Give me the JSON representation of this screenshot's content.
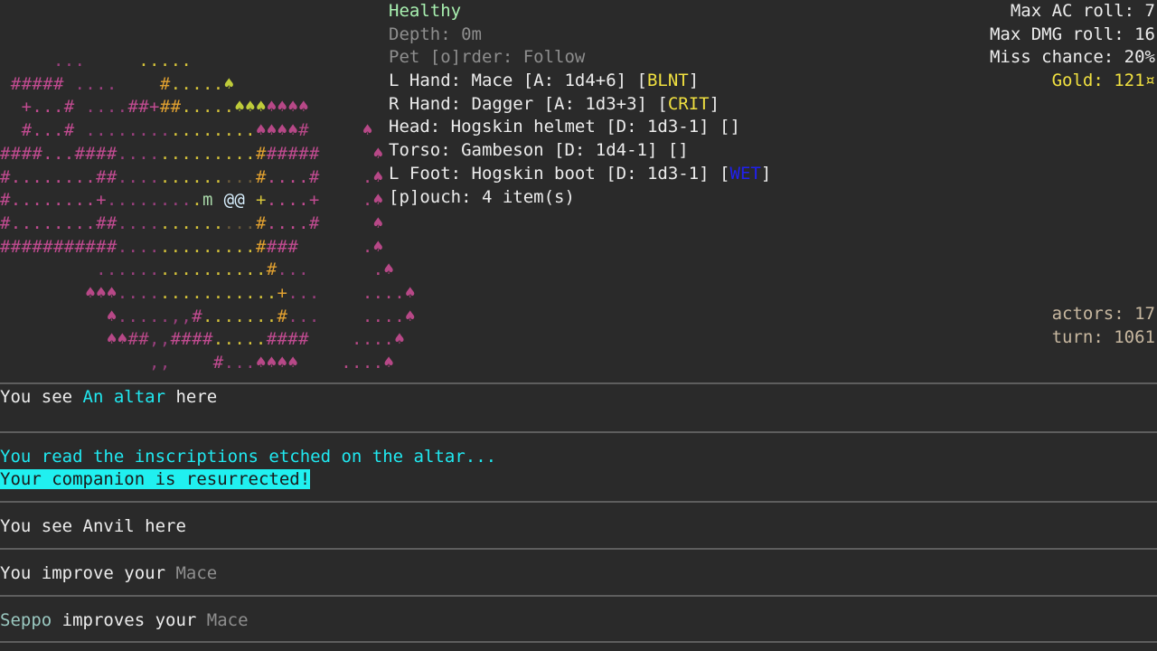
{
  "map": {
    "rows": [
      [
        {
          "t": "     ...     ",
          "c": "c-floor"
        },
        {
          "t": ".....",
          "c": "c-lit"
        }
      ],
      [
        {
          "t": " #####",
          "c": "c-wall"
        },
        {
          "t": " ....    ",
          "c": "c-floor"
        },
        {
          "t": "#",
          "c": "c-wallb"
        },
        {
          "t": ".....",
          "c": "c-lit"
        },
        {
          "t": "♠",
          "c": "c-treey"
        }
      ],
      [
        {
          "t": "  +...#",
          "c": "c-wall"
        },
        {
          "t": " ....",
          "c": "c-floor"
        },
        {
          "t": "##+",
          "c": "c-wall"
        },
        {
          "t": "##",
          "c": "c-wallb"
        },
        {
          "t": ".....",
          "c": "c-lit"
        },
        {
          "t": "♠♠♠",
          "c": "c-treey"
        },
        {
          "t": "♠♠♠♠",
          "c": "c-tree"
        }
      ],
      [
        {
          "t": "  #...#",
          "c": "c-wall"
        },
        {
          "t": " ........",
          "c": "c-floor"
        },
        {
          "t": "........",
          "c": "c-lit"
        },
        {
          "t": "♠♠♠♠#",
          "c": "c-tree"
        },
        {
          "t": "     ♠",
          "c": "c-tree"
        }
      ],
      [
        {
          "t": "####...####",
          "c": "c-wall"
        },
        {
          "t": "....",
          "c": "c-floor"
        },
        {
          "t": ".........",
          "c": "c-lit"
        },
        {
          "t": "#",
          "c": "c-wallb"
        },
        {
          "t": "#####",
          "c": "c-wall"
        },
        {
          "t": "     ♠",
          "c": "c-tree"
        }
      ],
      [
        {
          "t": "#........##",
          "c": "c-wall"
        },
        {
          "t": "....",
          "c": "c-floor"
        },
        {
          "t": "......",
          "c": "c-lit"
        },
        {
          "t": "...",
          "c": "c-dim"
        },
        {
          "t": "#",
          "c": "c-wallb"
        },
        {
          "t": "....#",
          "c": "c-wall"
        },
        {
          "t": "    .♠",
          "c": "c-tree"
        }
      ],
      [
        {
          "t": "#........+",
          "c": "c-wall"
        },
        {
          "t": "........",
          "c": "c-floor"
        },
        {
          "t": ".",
          "c": "c-lit"
        },
        {
          "t": "m",
          "c": "c-pet"
        },
        {
          "t": " ",
          "c": "c-floor"
        },
        {
          "t": "@@",
          "c": "c-player"
        },
        {
          "t": " +",
          "c": "c-lit"
        },
        {
          "t": "....+",
          "c": "c-wall"
        },
        {
          "t": "    .♠",
          "c": "c-tree"
        }
      ],
      [
        {
          "t": "#........##",
          "c": "c-wall"
        },
        {
          "t": "....",
          "c": "c-floor"
        },
        {
          "t": "......",
          "c": "c-lit"
        },
        {
          "t": "...",
          "c": "c-dim"
        },
        {
          "t": "#",
          "c": "c-wallb"
        },
        {
          "t": "....#",
          "c": "c-wall"
        },
        {
          "t": "     ♠",
          "c": "c-tree"
        }
      ],
      [
        {
          "t": "###########",
          "c": "c-wall"
        },
        {
          "t": "....",
          "c": "c-floor"
        },
        {
          "t": ".........",
          "c": "c-lit"
        },
        {
          "t": "#",
          "c": "c-wallb"
        },
        {
          "t": "###",
          "c": "c-wall"
        },
        {
          "t": "      .♠",
          "c": "c-tree"
        }
      ],
      [
        {
          "t": "         ......",
          "c": "c-floor"
        },
        {
          "t": "..........",
          "c": "c-lit"
        },
        {
          "t": "#",
          "c": "c-wallb"
        },
        {
          "t": "...",
          "c": "c-floor"
        },
        {
          "t": "      .♠",
          "c": "c-tree"
        }
      ],
      [
        {
          "t": "        ♠♠♠",
          "c": "c-tree"
        },
        {
          "t": "....",
          "c": "c-floor"
        },
        {
          "t": "...........",
          "c": "c-lit"
        },
        {
          "t": "+",
          "c": "c-wallb"
        },
        {
          "t": "...",
          "c": "c-floor"
        },
        {
          "t": "    ....♠",
          "c": "c-tree"
        }
      ],
      [
        {
          "t": "          ♠",
          "c": "c-tree"
        },
        {
          "t": ".....,,",
          "c": "c-floor"
        },
        {
          "t": "#",
          "c": "c-wall"
        },
        {
          "t": ".......",
          "c": "c-lit"
        },
        {
          "t": "#",
          "c": "c-wallb"
        },
        {
          "t": "...",
          "c": "c-floor"
        },
        {
          "t": "    ....♠",
          "c": "c-tree"
        }
      ],
      [
        {
          "t": "          ♠♠##",
          "c": "c-tree"
        },
        {
          "t": ",,",
          "c": "c-floor"
        },
        {
          "t": "####",
          "c": "c-wall"
        },
        {
          "t": ".....",
          "c": "c-lit"
        },
        {
          "t": "####",
          "c": "c-wall"
        },
        {
          "t": "    ....♠",
          "c": "c-tree"
        }
      ],
      [
        {
          "t": "              ,,",
          "c": "c-floor"
        },
        {
          "t": "    #",
          "c": "c-wall"
        },
        {
          "t": "...",
          "c": "c-floor"
        },
        {
          "t": "♠♠♠♠",
          "c": "c-tree"
        },
        {
          "t": "    ....♠",
          "c": "c-tree"
        }
      ]
    ]
  },
  "status": {
    "health": "Healthy",
    "depth": "Depth: 0m",
    "pet_order": "Pet [o]rder: Follow",
    "l_hand": {
      "label": "L Hand: Mace [A: 1d4+6] [",
      "tag": "BLNT",
      "close": "]"
    },
    "r_hand": {
      "label": "R Hand: Dagger [A: 1d3+3] [",
      "tag": "CRIT",
      "close": "]"
    },
    "head": "Head: Hogskin helmet [D: 1d3-1] []",
    "torso": "Torso: Gambeson [D: 1d4-1] []",
    "l_foot": {
      "label": "L Foot: Hogskin boot [D: 1d3-1] [",
      "tag": "WET",
      "close": "]"
    },
    "pouch": "[p]ouch: 4 item(s)"
  },
  "stats": {
    "max_ac": "Max AC roll: 7",
    "max_dmg": "Max DMG roll: 16",
    "miss": "Miss chance: 20%",
    "gold": "Gold: 121¤"
  },
  "world": {
    "actors": "actors: 17",
    "turn": "turn: 1061"
  },
  "log": {
    "e1": {
      "pre": "You see ",
      "obj": "An altar",
      "post": " here"
    },
    "e2": {
      "line1": "You read the inscriptions etched on the altar...",
      "line2": "Your companion is resurrected!"
    },
    "e3": "You see Anvil here",
    "e4": {
      "pre": "You improve your ",
      "item": "Mace"
    },
    "e5": {
      "actor": "Seppo",
      "mid": " improves your ",
      "item": "Mace"
    }
  },
  "colors": {
    "background": "#2a2a2a",
    "health_green": "#a8f0b0",
    "tag_yellow": "#f0e040",
    "wet_blue": "#2020f0",
    "highlight_cyan": "#20f0f0"
  }
}
